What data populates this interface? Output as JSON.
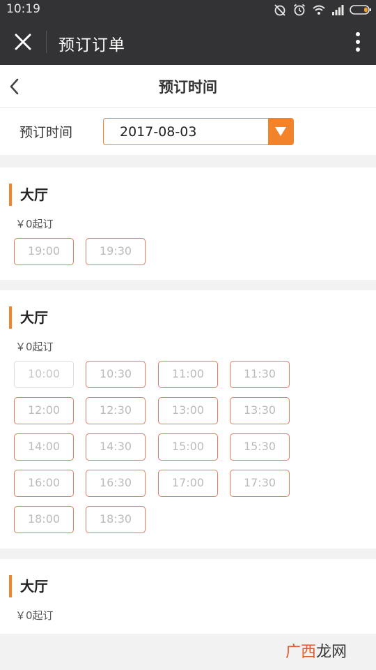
{
  "status_bar": {
    "time": "10:19"
  },
  "top_bar": {
    "title": "预订订单"
  },
  "sub_header": {
    "title": "预订时间"
  },
  "date_row": {
    "label": "预订时间",
    "selected_date": "2017-08-03"
  },
  "sections": [
    {
      "title": "大厅",
      "price": "￥0起订",
      "slots": [
        {
          "time": "19:00",
          "available": true
        },
        {
          "time": "19:30",
          "available": true
        }
      ]
    },
    {
      "title": "大厅",
      "price": "￥0起订",
      "slots": [
        {
          "time": "10:00",
          "available": false
        },
        {
          "time": "10:30",
          "available": true
        },
        {
          "time": "11:00",
          "available": true
        },
        {
          "time": "11:30",
          "available": true
        },
        {
          "time": "12:00",
          "available": true
        },
        {
          "time": "12:30",
          "available": true
        },
        {
          "time": "13:00",
          "available": true
        },
        {
          "time": "13:30",
          "available": true
        },
        {
          "time": "14:00",
          "available": true
        },
        {
          "time": "14:30",
          "available": true
        },
        {
          "time": "15:00",
          "available": true
        },
        {
          "time": "15:30",
          "available": true
        },
        {
          "time": "16:00",
          "available": true
        },
        {
          "time": "16:30",
          "available": true
        },
        {
          "time": "17:00",
          "available": true
        },
        {
          "time": "17:30",
          "available": true
        },
        {
          "time": "18:00",
          "available": true
        },
        {
          "time": "18:30",
          "available": true
        }
      ]
    },
    {
      "title": "大厅",
      "price": "￥0起订",
      "slots": []
    }
  ],
  "watermark": {
    "part1": "广西",
    "part2": "龙网"
  },
  "colors": {
    "accent": "#f2832a",
    "slot_border": "#e57a5a",
    "topbar": "#333336"
  },
  "icons": [
    "alarm-off-icon",
    "alarm-clock-icon",
    "wifi-icon",
    "signal-icon",
    "battery-icon",
    "close-icon",
    "more-vertical-icon",
    "back-chevron-icon",
    "dropdown-triangle-icon"
  ]
}
